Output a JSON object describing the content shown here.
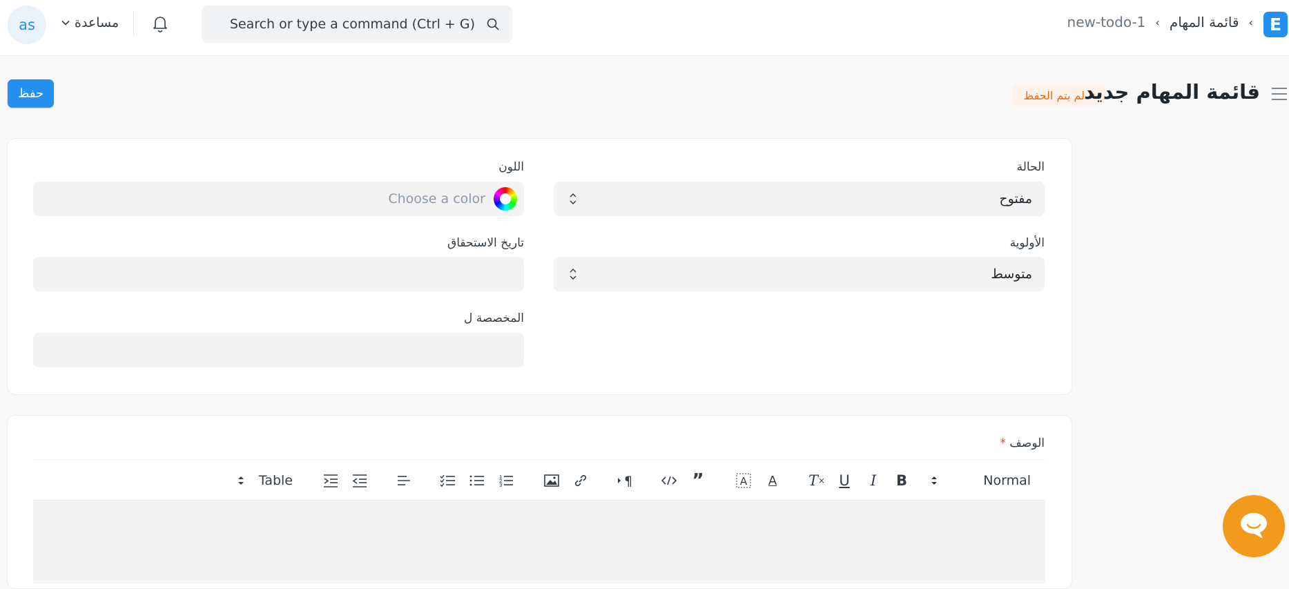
{
  "navbar": {
    "avatar_initials": "as",
    "help_label": "مساعدة",
    "search_placeholder": "Search or type a command (Ctrl + G)",
    "breadcrumb": {
      "parent": "قائمة المهام",
      "current": "new-todo-1"
    },
    "logo_letter": "E"
  },
  "page": {
    "title": "قائمة المهام جديد",
    "status_badge": "لم يتم الحفظ",
    "save_label": "حفظ"
  },
  "form": {
    "status": {
      "label": "الحالة",
      "value": "مفتوح"
    },
    "color": {
      "label": "اللون",
      "placeholder": "Choose a color"
    },
    "priority": {
      "label": "الأولوية",
      "value": "متوسط"
    },
    "due_date": {
      "label": "تاريخ الاستحقاق",
      "value": ""
    },
    "assigned_to": {
      "label": "المخصصة ل",
      "value": ""
    },
    "description": {
      "label": "الوصف",
      "required_mark": "*"
    }
  },
  "toolbar": {
    "text_style": "Normal",
    "table_label": "Table",
    "icons": [
      "bold-icon",
      "italic-icon",
      "underline-icon",
      "clear-format-icon",
      "text-color-icon",
      "highlight-icon",
      "quote-icon",
      "code-icon",
      "paragraph-direction-icon",
      "link-icon",
      "image-icon",
      "ordered-list-icon",
      "bullet-list-icon",
      "checklist-icon",
      "align-icon",
      "outdent-icon",
      "indent-icon"
    ]
  },
  "colors": {
    "primary": "#2490ef",
    "warning": "#e86c13",
    "chat": "#f19a1b"
  }
}
